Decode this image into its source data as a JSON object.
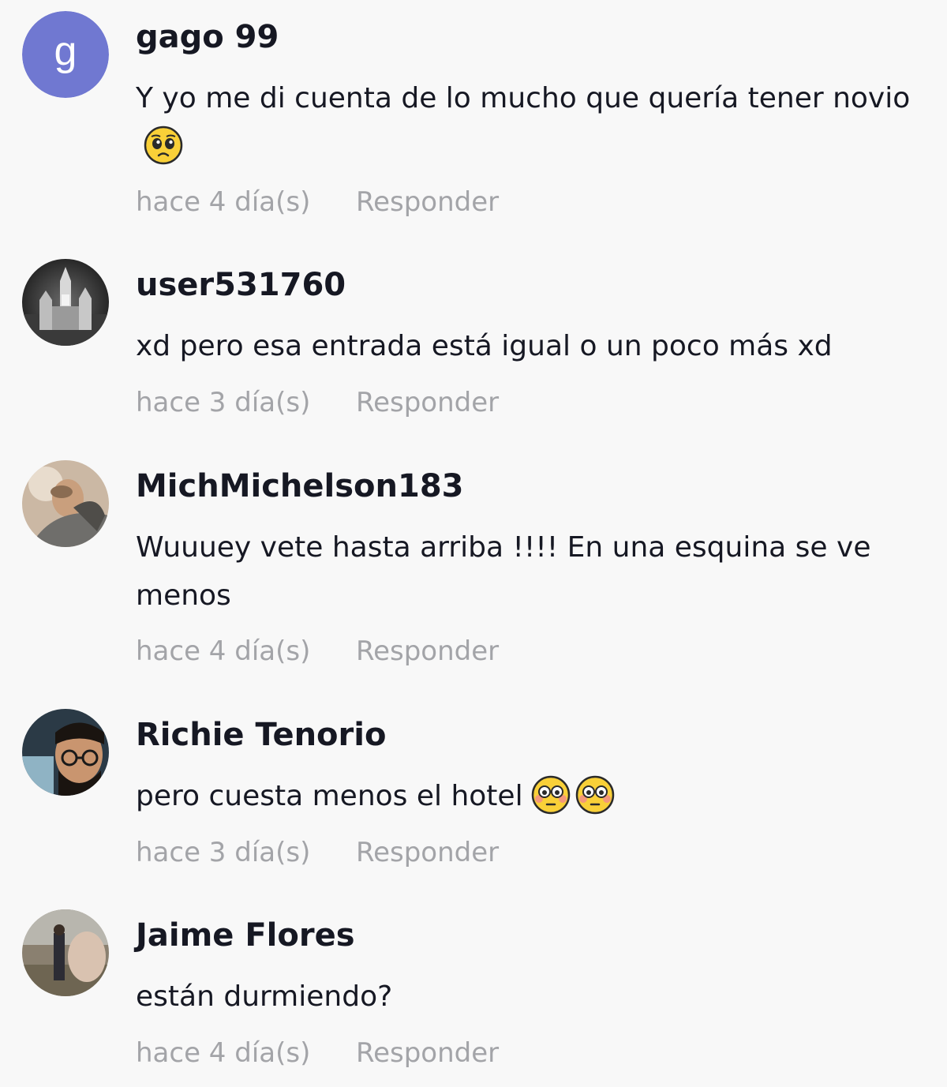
{
  "comments": [
    {
      "username": "gago 99",
      "avatar_initial": "g",
      "text": "Y yo me di cuenta de lo mucho que quería tener novio",
      "emojis": [
        "pleading-face"
      ],
      "time": "hace 4 día(s)",
      "reply_label": "Responder"
    },
    {
      "username": "user531760",
      "text": "xd pero esa entrada está igual o un poco más xd",
      "emojis": [],
      "time": "hace 3 día(s)",
      "reply_label": "Responder"
    },
    {
      "username": "MichMichelson183",
      "text": "Wuuuey vete hasta arriba !!!! En una esquina se ve menos",
      "emojis": [],
      "time": "hace 4 día(s)",
      "reply_label": "Responder"
    },
    {
      "username": "Richie Tenorio",
      "text": "pero cuesta menos el hotel",
      "emojis": [
        "flushed-face",
        "flushed-face"
      ],
      "time": "hace 3 día(s)",
      "reply_label": "Responder"
    },
    {
      "username": "Jaime Flores",
      "text": "están durmiendo?",
      "emojis": [],
      "time": "hace 4 día(s)",
      "reply_label": "Responder"
    }
  ],
  "colors": {
    "background": "#f8f8f8",
    "text": "#161823",
    "meta": "#a3a4a8",
    "initial_avatar": "#7078d1"
  }
}
